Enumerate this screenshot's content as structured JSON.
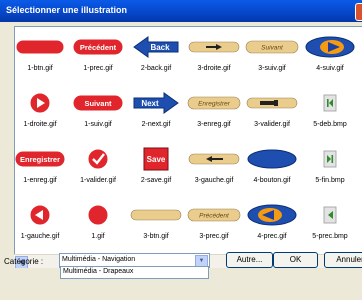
{
  "window": {
    "title": "Sélectionner une illustration"
  },
  "gallery": {
    "items": [
      {
        "file": "1-btn.gif",
        "kind": "pill-red",
        "text": ""
      },
      {
        "file": "1-prec.gif",
        "kind": "pill-red-text",
        "text": "Précédent"
      },
      {
        "file": "2-back.gif",
        "kind": "arrow-left-blue",
        "text": "Back"
      },
      {
        "file": "3-droite.gif",
        "kind": "beige-arrow-right",
        "text": ""
      },
      {
        "file": "3-suiv.gif",
        "kind": "beige-text",
        "text": "Suivant"
      },
      {
        "file": "4-suiv.gif",
        "kind": "blue-oval-arrow-right",
        "text": ""
      },
      {
        "file": "1-droite.gif",
        "kind": "red-circle-play",
        "text": ""
      },
      {
        "file": "1-suiv.gif",
        "kind": "pill-red-text",
        "text": "Suivant"
      },
      {
        "file": "2-next.gif",
        "kind": "arrow-right-blue",
        "text": "Next"
      },
      {
        "file": "3-enreg.gif",
        "kind": "beige-text",
        "text": "Enregistrer"
      },
      {
        "file": "3-valider.gif",
        "kind": "beige-valider",
        "text": ""
      },
      {
        "file": "5-deb.bmp",
        "kind": "green-first",
        "text": ""
      },
      {
        "file": "1-enreg.gif",
        "kind": "pill-red-text",
        "text": "Enregistrer"
      },
      {
        "file": "1-valider.gif",
        "kind": "red-circle-check",
        "text": ""
      },
      {
        "file": "2-save.gif",
        "kind": "save-square",
        "text": "Save"
      },
      {
        "file": "3-gauche.gif",
        "kind": "beige-arrow-left",
        "text": ""
      },
      {
        "file": "4-bouton.gif",
        "kind": "blue-oval",
        "text": ""
      },
      {
        "file": "5-fin.bmp",
        "kind": "green-last",
        "text": ""
      },
      {
        "file": "1-gauche.gif",
        "kind": "red-circle-left",
        "text": ""
      },
      {
        "file": "1.gif",
        "kind": "red-circle",
        "text": ""
      },
      {
        "file": "3-btn.gif",
        "kind": "beige-pill",
        "text": ""
      },
      {
        "file": "3-prec.gif",
        "kind": "beige-text",
        "text": "Précédent"
      },
      {
        "file": "4-prec.gif",
        "kind": "blue-oval-arrow-left",
        "text": ""
      },
      {
        "file": "5-prec.bmp",
        "kind": "green-prev",
        "text": ""
      }
    ]
  },
  "footer": {
    "category_label": "Catégorie :",
    "category_value": "Multimédia - Navigation",
    "dropdown_option": "Multimédia - Drapeaux",
    "autre_label": "Autre...",
    "ok_label": "OK",
    "annuler_label": "Annuler"
  },
  "icons": {
    "close": "close-icon",
    "scroll_left": "scroll-left-arrow-icon",
    "dropdown": "chevron-down-icon"
  },
  "colors": {
    "title_bar": "#0A5BE8",
    "red_button": "#E0262C",
    "blue_button": "#1E4FB0",
    "beige_button": "#EACC8C",
    "orange": "#F59B12",
    "green": "#2E8B2E"
  }
}
